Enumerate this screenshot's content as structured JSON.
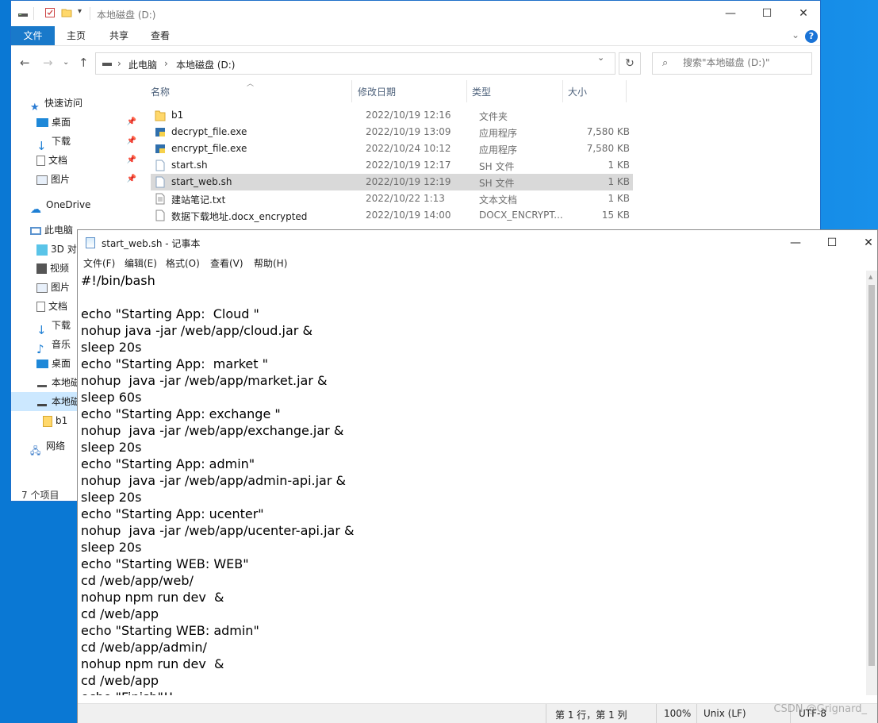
{
  "explorer": {
    "title": "本地磁盘 (D:)",
    "ribbon_tabs": [
      "文件",
      "主页",
      "共享",
      "查看"
    ],
    "breadcrumb": [
      "此电脑",
      "本地磁盘 (D:)"
    ],
    "search_placeholder": "搜索\"本地磁盘 (D:)\"",
    "columns": {
      "name": "名称",
      "date": "修改日期",
      "type": "类型",
      "size": "大小"
    },
    "files": [
      {
        "name": "b1",
        "date": "2022/10/19 12:16",
        "type": "文件夹",
        "size": "",
        "icon": "folder-icon"
      },
      {
        "name": "decrypt_file.exe",
        "date": "2022/10/19 13:09",
        "type": "应用程序",
        "size": "7,580 KB",
        "icon": "python-exe-icon"
      },
      {
        "name": "encrypt_file.exe",
        "date": "2022/10/24 10:12",
        "type": "应用程序",
        "size": "7,580 KB",
        "icon": "python-exe-icon"
      },
      {
        "name": "start.sh",
        "date": "2022/10/19 12:17",
        "type": "SH 文件",
        "size": "1 KB",
        "icon": "file-icon"
      },
      {
        "name": "start_web.sh",
        "date": "2022/10/19 12:19",
        "type": "SH 文件",
        "size": "1 KB",
        "icon": "file-icon",
        "selected": true
      },
      {
        "name": "建站笔记.txt",
        "date": "2022/10/22 1:13",
        "type": "文本文档",
        "size": "1 KB",
        "icon": "text-file-icon"
      },
      {
        "name": "数据下载地址.docx_encrypted",
        "date": "2022/10/19 14:00",
        "type": "DOCX_ENCRYPT...",
        "size": "15 KB",
        "icon": "file-icon"
      }
    ],
    "nav": {
      "quick_access": "快速访问",
      "qa_items": [
        "桌面",
        "下载",
        "文档",
        "图片"
      ],
      "onedrive": "OneDrive",
      "this_pc": "此电脑",
      "pc_items": [
        "3D 对",
        "视频",
        "图片",
        "文档",
        "下载",
        "音乐",
        "桌面",
        "本地磁"
      ],
      "b1": "b1",
      "network": "网络"
    },
    "status": "7 个项目"
  },
  "notepad": {
    "title": "start_web.sh - 记事本",
    "menu": [
      "文件(F)",
      "编辑(E)",
      "格式(O)",
      "查看(V)",
      "帮助(H)"
    ],
    "lines": [
      "#!/bin/bash",
      "",
      "echo \"Starting App:  Cloud \"",
      "nohup java -jar /web/app/cloud.jar &",
      "sleep 20s",
      "echo \"Starting App:  market \"",
      "nohup  java -jar /web/app/market.jar &",
      "sleep 60s",
      "echo \"Starting App: exchange \"",
      "nohup  java -jar /web/app/exchange.jar &",
      "sleep 20s",
      "echo \"Starting App: admin\"",
      "nohup  java -jar /web/app/admin-api.jar &",
      "sleep 20s",
      "echo \"Starting App: ucenter\"",
      "nohup  java -jar /web/app/ucenter-api.jar &",
      "sleep 20s",
      "echo \"Starting WEB: WEB\"",
      "cd /web/app/web/",
      "nohup npm run dev  &",
      "cd /web/app",
      "echo \"Starting WEB: admin\"",
      "cd /web/app/admin/",
      "nohup npm run dev  &",
      "cd /web/app",
      "echo \"Finish\"!!"
    ],
    "status": {
      "position": "第 1 行，第 1 列",
      "zoom": "100%",
      "eol": "Unix (LF)",
      "encoding": "UTF-8"
    }
  },
  "watermark": "CSDN @Grignard_"
}
